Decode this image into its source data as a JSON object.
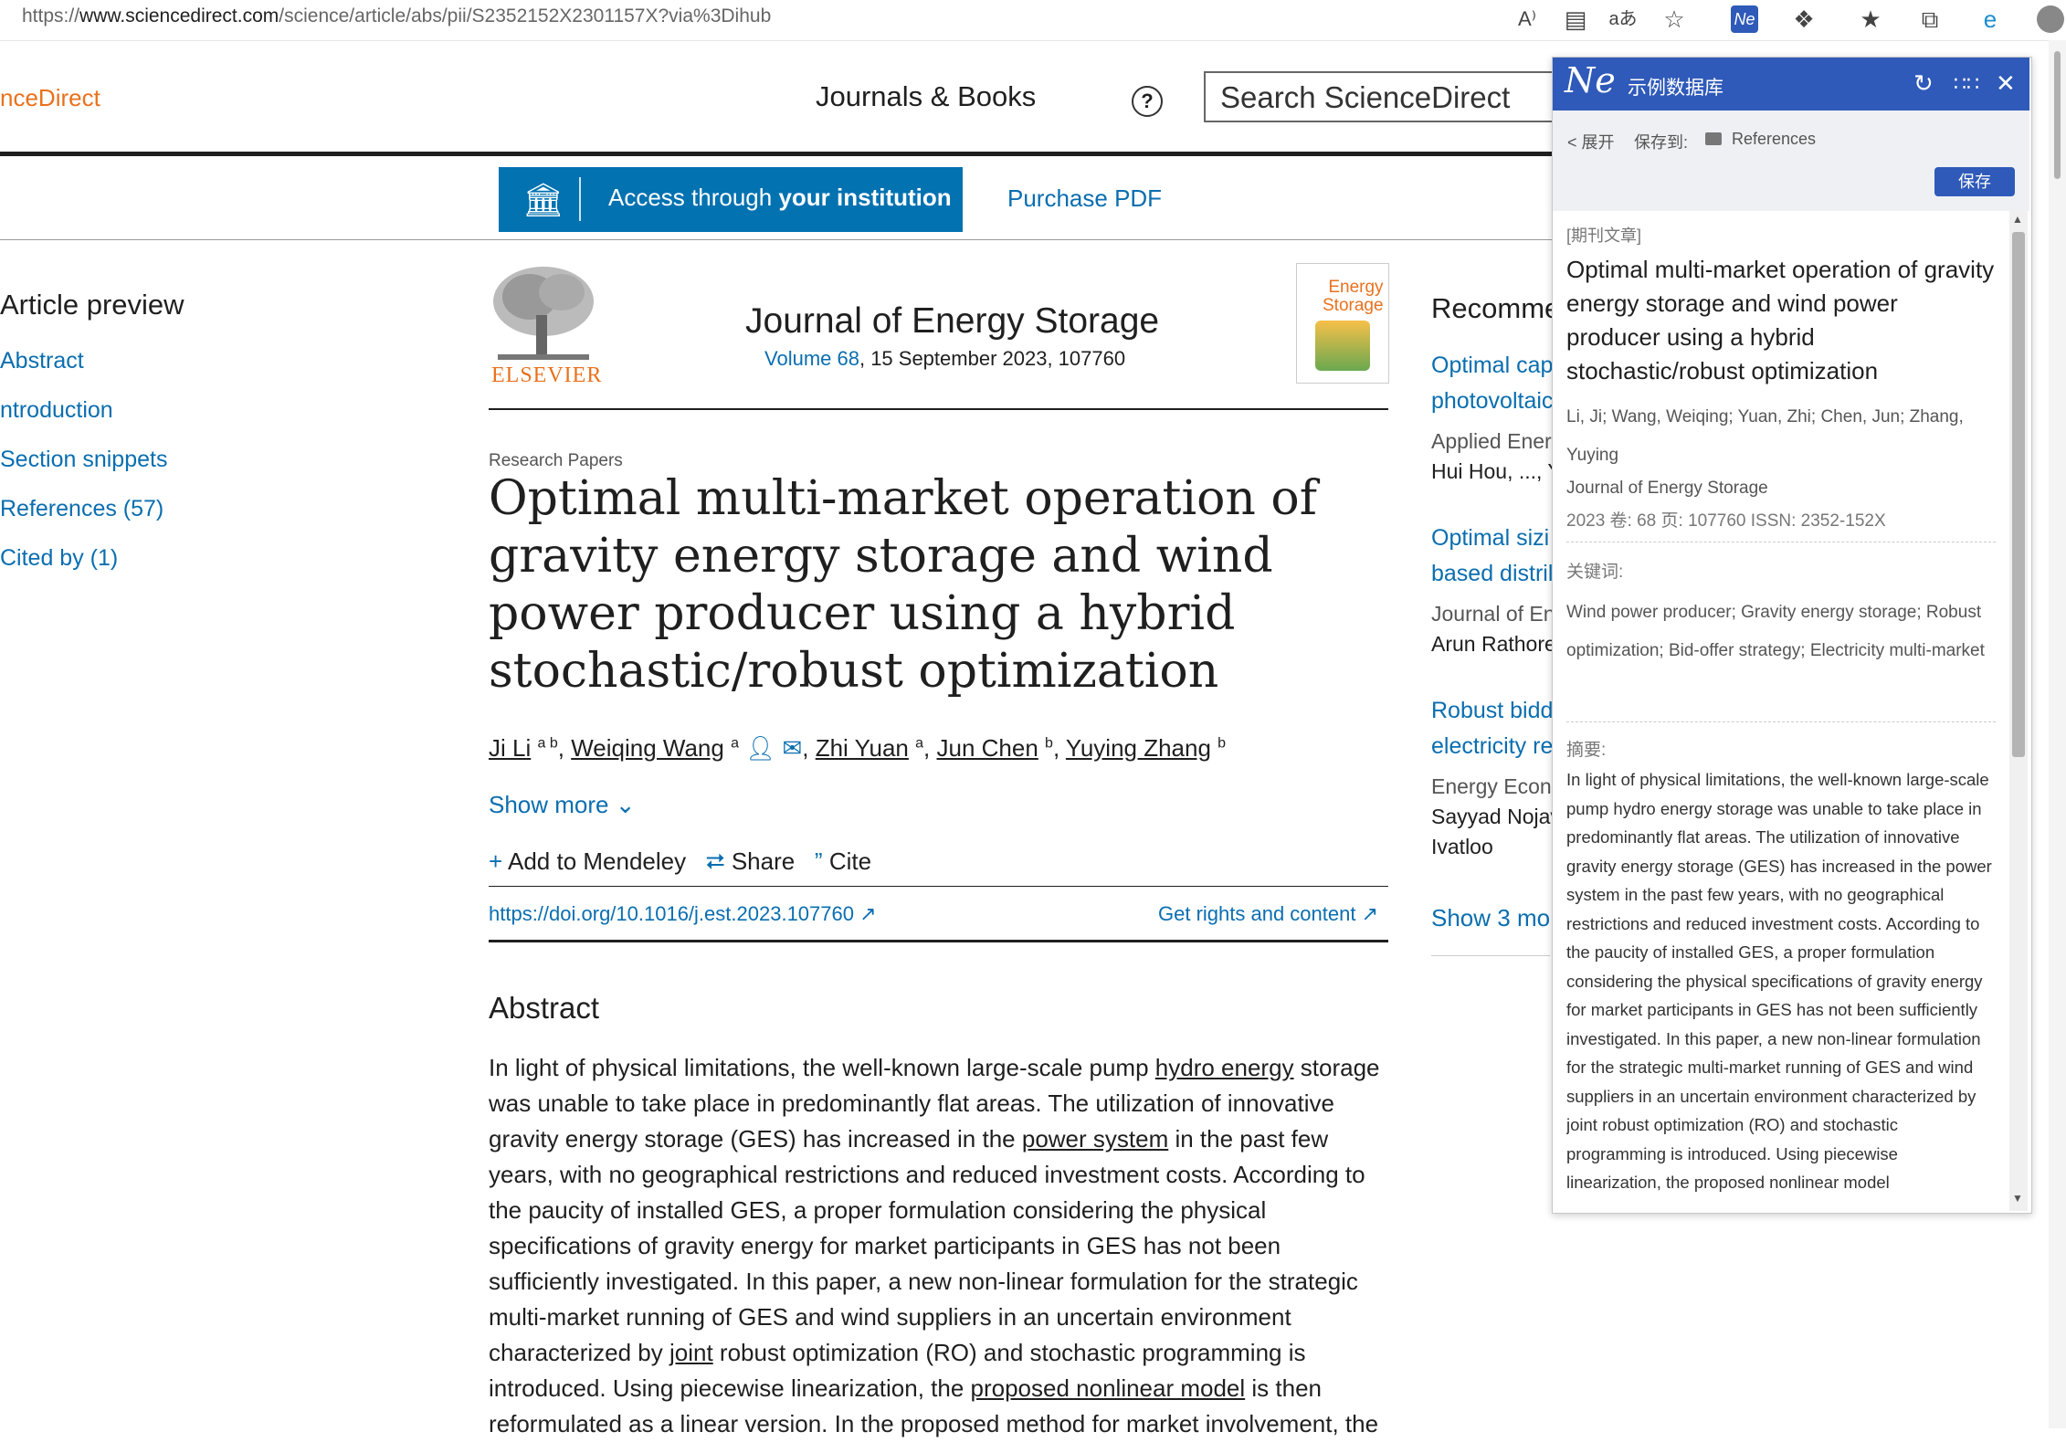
{
  "browser": {
    "url_prefix": "https://",
    "url_domain": "www.sciencedirect.com",
    "url_path": "/science/article/abs/pii/S2352152X2301157X?via%3Dihub",
    "toolbar_icons": [
      "read-aloud-icon",
      "immersive-reader-icon",
      "translate-icon",
      "favorite-add-icon",
      "extension-ne-icon",
      "extensions-icon",
      "favorites-icon",
      "collections-icon",
      "edge-icon",
      "profile-avatar"
    ]
  },
  "header": {
    "logo": "nceDirect",
    "journals_books": "Journals & Books",
    "help": "?",
    "search_placeholder": "Search ScienceDirect"
  },
  "access": {
    "access_pre": "Access through ",
    "access_bold": "your institution",
    "purchase": "Purchase PDF"
  },
  "nav": {
    "title": "Article preview",
    "items": [
      "Abstract",
      "ntroduction",
      "Section snippets",
      "References (57)",
      "Cited by (1)"
    ]
  },
  "journal": {
    "publisher": "ELSEVIER",
    "name": "Journal of Energy Storage",
    "volume": "Volume 68",
    "date_line": ", 15 September 2023, 107760",
    "cover_title_1": "Energy",
    "cover_title_2": "Storage"
  },
  "article": {
    "section": "Research Papers",
    "title": "Optimal multi-market operation of gravity energy storage and wind power producer using a hybrid stochastic/robust optimization",
    "authors": [
      {
        "name": "Ji Li",
        "sup": "a b"
      },
      {
        "name": "Weiqing Wang",
        "sup": "a"
      },
      {
        "name": "Zhi Yuan",
        "sup": "a"
      },
      {
        "name": "Jun Chen",
        "sup": "b"
      },
      {
        "name": "Yuying Zhang",
        "sup": "b"
      }
    ],
    "show_more": "Show more",
    "actions": {
      "mendeley": "Add to Mendeley",
      "share": "Share",
      "cite": "Cite"
    },
    "doi": "https://doi.org/10.1016/j.est.2023.107760",
    "rights": "Get rights and content",
    "abstract_heading": "Abstract",
    "abstract_parts": [
      "In light of physical limitations, the well-known large-scale pump ",
      "hydro energy",
      " storage was unable to take place in predominantly flat areas. The utilization of innovative gravity energy storage (GES) has increased in the ",
      "power system",
      " in the past few years, with no geographical restrictions and reduced investment costs. According to the paucity of installed GES, a proper formulation considering the physical specifications of gravity energy for market participants in GES has not been sufficiently investigated. In this paper, a new non-linear formulation for the strategic multi-market running of GES and wind suppliers in an uncertain environment characterized by ",
      "joint",
      " robust optimization (RO) and stochastic programming is introduced. Using piecewise linearization, the ",
      "proposed nonlinear model",
      " is then reformulated as a linear version. In the proposed method for market involvement, the"
    ]
  },
  "recommended": {
    "title": "Recomme",
    "items": [
      {
        "l1": "Optimal cap",
        "l2": "photovoltaic",
        "meta": "Applied Energ",
        "auth": "Hui Hou, ..., Y"
      },
      {
        "l1": "Optimal sizi",
        "l2": "based distril",
        "meta": "Journal of En",
        "auth": "Arun Rathore"
      },
      {
        "l1": "Robust bidd",
        "l2": "electricity re",
        "meta": "Energy Econo",
        "auth": "Sayyad Nojav",
        "auth2": "Ivatloo"
      }
    ],
    "show_more": "Show 3 mo"
  },
  "plugin": {
    "logo": "Ne",
    "name": "示例数据库",
    "expand": "< 展开",
    "save_to": "保存到:",
    "folder": "References",
    "save": "保存",
    "type": "[期刊文章]",
    "title": "Optimal multi-market operation of gravity energy storage and wind power producer using a hybrid stochastic/robust optimization",
    "authors": "Li, Ji; Wang, Weiqing; Yuan, Zhi; Chen, Jun; Zhang, Yuying",
    "journal": "Journal of Energy Storage",
    "meta": "2023  卷: 68   页: 107760    ISSN: 2352-152X",
    "keywords_label": "关键词:",
    "keywords": "Wind power producer; Gravity energy storage; Robust optimization; Bid-offer strategy; Electricity multi-market",
    "abstract_label": "摘要:",
    "abstract": "In light of physical limitations, the well-known large-scale pump hydro energy storage was unable to take place in predominantly flat areas. The utilization of innovative gravity energy storage (GES) has increased in the power system in the past few years, with no geographical restrictions and reduced investment costs. According to the paucity of installed GES, a proper formulation considering the physical specifications of gravity energy for market participants in GES has not been sufficiently investigated. In this paper, a new non-linear formulation for the strategic multi-market running of GES and wind suppliers in an uncertain environment characterized by joint robust optimization (RO) and stochastic programming is introduced. Using piecewise linearization, the proposed nonlinear model"
  }
}
